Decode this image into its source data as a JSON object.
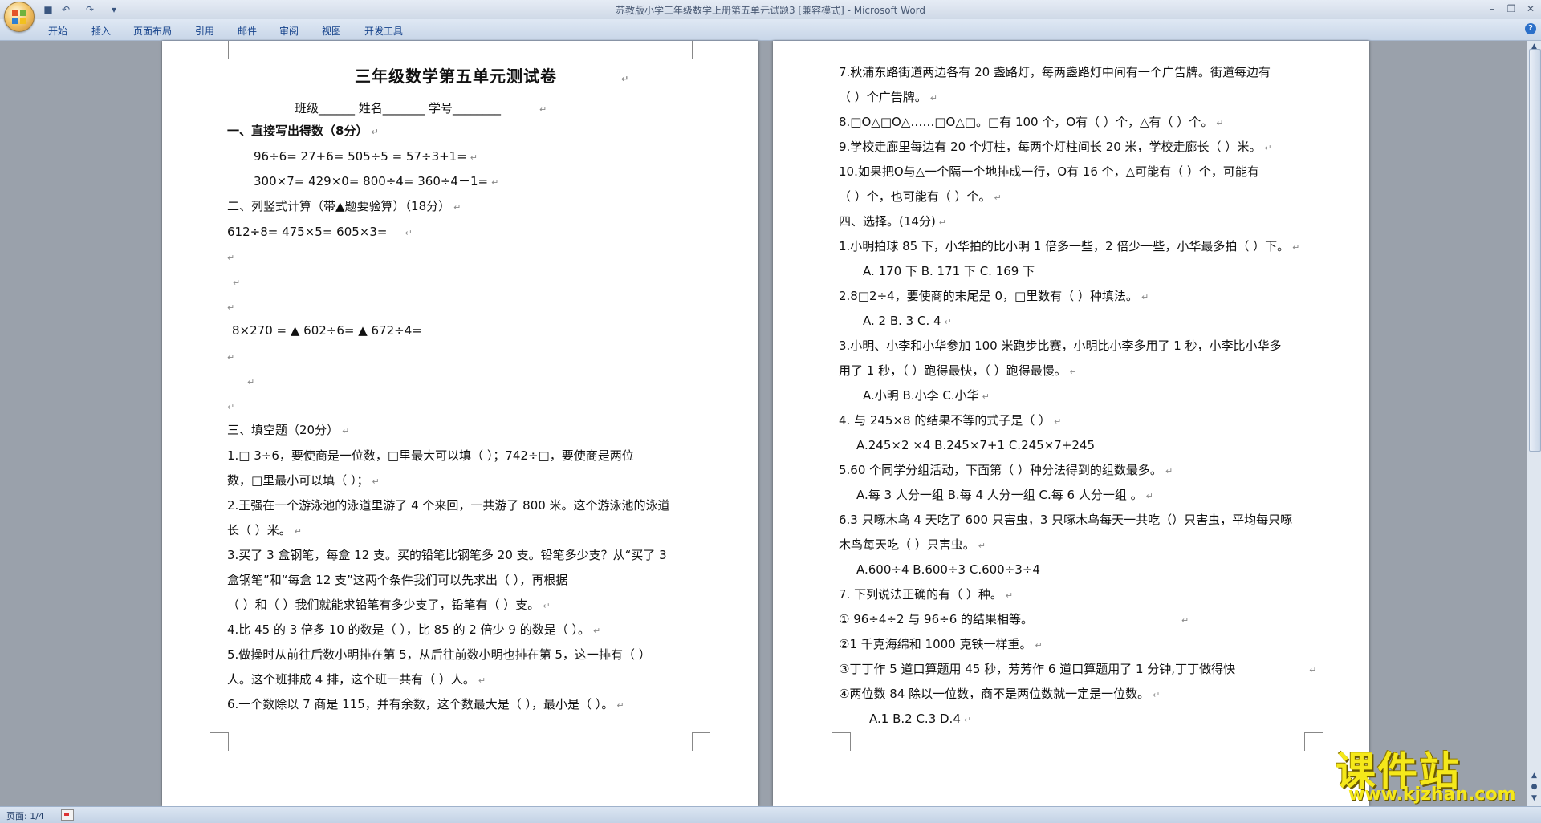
{
  "window": {
    "title": "苏教版小学三年级数学上册第五单元试题3 [兼容模式] - Microsoft Word"
  },
  "ribbon": {
    "tabs": [
      "开始",
      "插入",
      "页面布局",
      "引用",
      "邮件",
      "审阅",
      "视图",
      "开发工具"
    ]
  },
  "status": {
    "page": "页面: 1/4"
  },
  "watermark": {
    "name": "课件站",
    "url": "www.kjzhan.com"
  },
  "page1": {
    "lines": [
      "三年级数学第五单元测试卷",
      "班级______   姓名_______       学号________",
      "一、直接写出得数（8分）",
      "96÷6=        27+6=          505÷5 =        57÷3+1=",
      "300×7=       429×0=         800÷4=         360÷4－1=",
      "二、列竖式计算（带▲题要验算）（18分）",
      "612÷8=                      475×5=             605×3=",
      "8×270 =              ▲  602÷6=               ▲  672÷4=",
      "三、填空题（20分）",
      "1.□ 3÷6，要使商是一位数，□里最大可以填（      ）；742÷□，要使商是两位",
      "数，□里最小可以填（      ）；",
      "2.王强在一个游泳池的泳道里游了 4 个来回，一共游了 800 米。这个游泳池的泳道",
      "长（      ）米。",
      "3.买了 3 盒钢笔，每盒 12 支。买的铅笔比钢笔多 20 支。铅笔多少支？从“买了 3",
      "盒钢笔”和“每盒 12 支”这两个条件我们可以先求出（            ），再根据",
      "（            ）和（            ）我们就能求铅笔有多少支了，铅笔有（      ）支。",
      "4.比 45 的 3 倍多 10 的数是（    ），比 85 的 2 倍少 9 的数是（    ）。",
      "5.做操时从前往后数小明排在第 5，从后往前数小明也排在第 5，这一排有（      ）",
      "人。这个班排成 4 排，这个班一共有（    ）人。",
      "6.一个数除以 7 商是 115，并有余数，这个数最大是（    ），最小是（      ）。"
    ]
  },
  "page2": {
    "lines": [
      "7.秋浦东路街道两边各有  20  盏路灯，每两盏路灯中间有一个广告牌。街道每边有",
      "（      ）个广告牌。",
      "8.□O△□O△……□O△□。□有 100 个，O有（      ）个，△有（      ）个。",
      "9.学校走廊里每边有 20 个灯柱，每两个灯柱间长 20 米，学校走廊长（      ）米。",
      "10.如果把O与△一个隔一个地排成一行，O有 16 个，△可能有（    ）个，可能有",
      "（    ）个，也可能有（    ）个。",
      "四、选择。(14分)",
      "1.小明拍球 85 下，小华拍的比小明 1 倍多一些，2 倍少一些，小华最多拍（    ）下。",
      "A. 170 下          B. 171 下             C. 169 下",
      "2.8□2÷4，要使商的末尾是 0，□里数有（      ）种填法。",
      "A. 2          B. 3          C. 4",
      "3.小明、小李和小华参加 100 米跑步比赛，小明比小李多用了 1 秒，小李比小华多",
      "用了 1 秒，（      ）跑得最快，（        ）跑得最慢。",
      "A.小明                B.小李           C.小华",
      "4. 与 245×8 的结果不等的式子是（        ）",
      "A.245×2 ×4          B.245×7+1       C.245×7+245",
      "5.60 个同学分组活动，下面第（      ）种分法得到的组数最多。",
      "A.每 3 人分一组          B.每 4 人分一组        C.每 6 人分一组  。",
      "6.3 只啄木鸟 4 天吃了 600 只害虫，3 只啄木鸟每天一共吃（）只害虫，平均每只啄",
      "木鸟每天吃（      ）只害虫。",
      "A.600÷4            B.600÷3             C.600÷3÷4",
      "7. 下列说法正确的有（   ）种。",
      "①  96÷4÷2 与 96÷6 的结果相等。",
      "②1 千克海绵和 1000 克铁一样重。",
      "③丁丁作 5 道口算题用 45 秒，芳芳作 6 道口算题用了 1 分钟,丁丁做得快",
      "④两位数 84 除以一位数，商不是两位数就一定是一位数。",
      "A.1               B.2                   C.3                      D.4"
    ]
  }
}
